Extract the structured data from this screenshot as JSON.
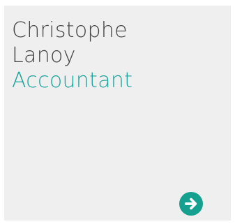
{
  "person": {
    "first_name": "Christophe",
    "last_name": "Lanoy",
    "role": "Accountant"
  },
  "colors": {
    "card_background": "#efefef",
    "text": "#444444",
    "accent": "#1aa39a",
    "button": "#15a08f"
  },
  "icons": {
    "action": "arrow-right-icon"
  }
}
